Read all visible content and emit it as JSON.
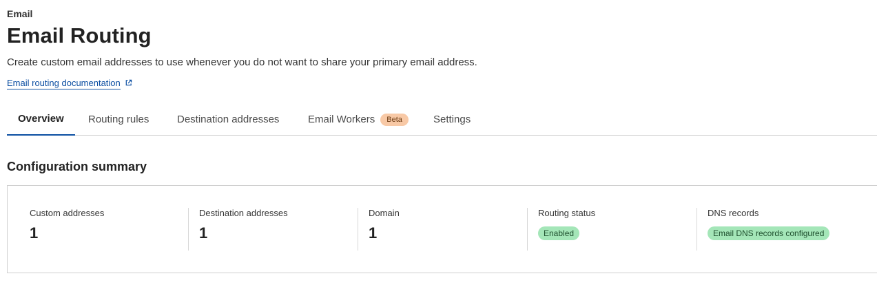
{
  "header": {
    "eyebrow": "Email",
    "title": "Email Routing",
    "subtitle": "Create custom email addresses to use whenever you do not want to share your primary email address.",
    "doc_link": "Email routing documentation"
  },
  "tabs": [
    {
      "label": "Overview",
      "active": true
    },
    {
      "label": "Routing rules",
      "active": false
    },
    {
      "label": "Destination addresses",
      "active": false
    },
    {
      "label": "Email Workers",
      "active": false,
      "badge": "Beta"
    },
    {
      "label": "Settings",
      "active": false
    }
  ],
  "summary": {
    "title": "Configuration summary",
    "stats": [
      {
        "label": "Custom addresses",
        "value": "1"
      },
      {
        "label": "Destination addresses",
        "value": "1"
      },
      {
        "label": "Domain",
        "value": "1"
      },
      {
        "label": "Routing status",
        "status": "Enabled"
      },
      {
        "label": "DNS records",
        "status": "Email DNS records configured"
      }
    ]
  },
  "colors": {
    "link": "#0b4ea2",
    "beta_badge": "#f8c9a6",
    "status_pill": "#a4e6b8"
  },
  "icons": {
    "doc_link": "external-link-icon"
  }
}
